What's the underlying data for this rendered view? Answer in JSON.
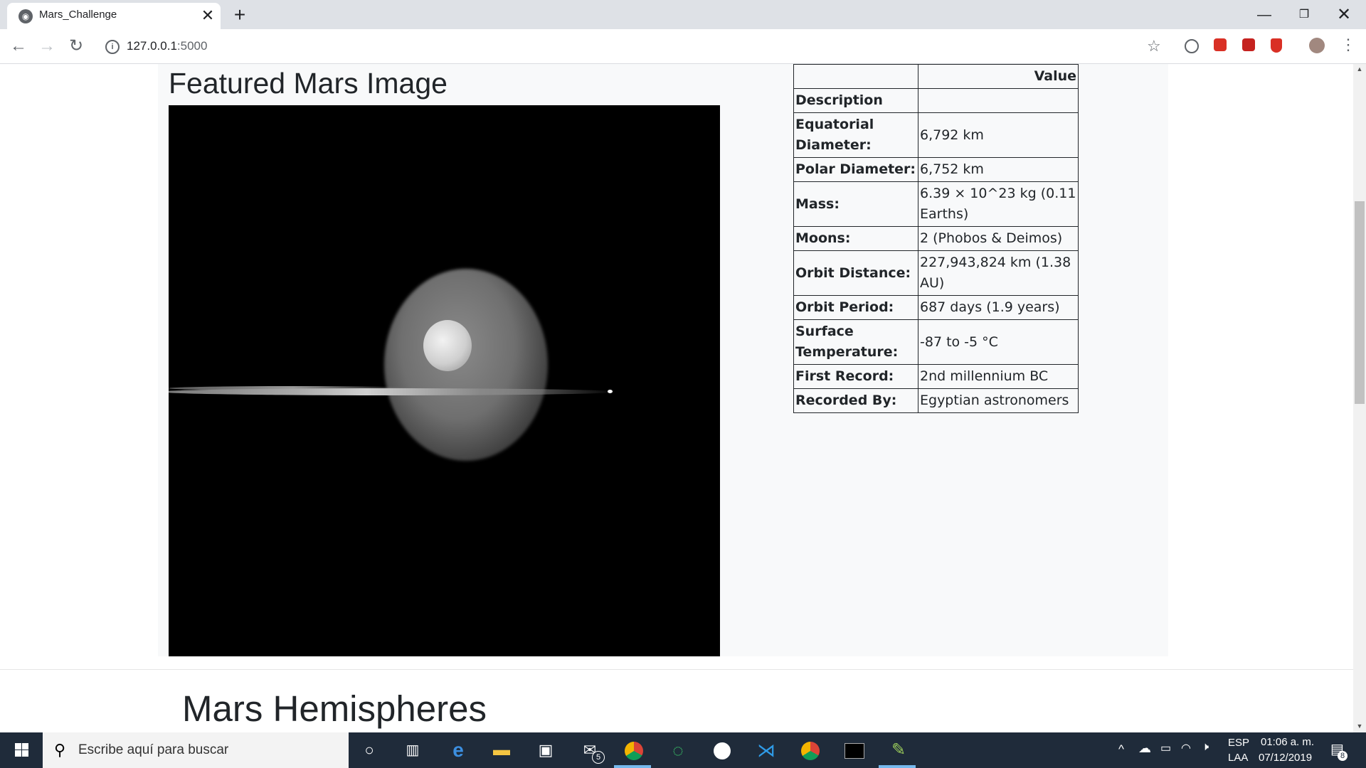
{
  "browser": {
    "tab_title": "Mars_Challenge",
    "tab_close": "✕",
    "new_tab": "+",
    "url_host": "127.0.0.1",
    "url_port": ":5000",
    "window_controls": {
      "minimize": "—",
      "maximize": "❐",
      "close": "✕"
    },
    "icons": {
      "back": "←",
      "forward": "→",
      "reload": "↻",
      "info": "i",
      "star": "☆",
      "menu": "⋮"
    }
  },
  "page": {
    "featured_title": "Featured Mars Image",
    "facts_table": {
      "header": [
        "",
        "Value"
      ],
      "rows": [
        {
          "key": "Description",
          "value": ""
        },
        {
          "key": "Equatorial Diameter:",
          "value": "6,792 km"
        },
        {
          "key": "Polar Diameter:",
          "value": "6,752 km"
        },
        {
          "key": "Mass:",
          "value": "6.39 × 10^23 kg (0.11 Earths)"
        },
        {
          "key": "Moons:",
          "value": "2 (Phobos & Deimos)"
        },
        {
          "key": "Orbit Distance:",
          "value": "227,943,824 km (1.38 AU)"
        },
        {
          "key": "Orbit Period:",
          "value": "687 days (1.9 years)"
        },
        {
          "key": "Surface Temperature:",
          "value": "-87 to -5 °C"
        },
        {
          "key": "First Record:",
          "value": "2nd millennium BC"
        },
        {
          "key": "Recorded By:",
          "value": "Egyptian astronomers"
        }
      ]
    },
    "hemispheres_title": "Mars Hemispheres"
  },
  "taskbar": {
    "search_placeholder": "Escribe aquí para buscar",
    "mail_badge": "5",
    "lang_top": "ESP",
    "lang_bottom": "LAA",
    "time": "01:06 a. m.",
    "date": "07/12/2019",
    "notification_badge": "8",
    "icons": [
      "windows-start-icon",
      "search-icon",
      "cortana-icon",
      "task-view-icon",
      "edge-icon",
      "file-explorer-icon",
      "store-icon",
      "mail-icon",
      "chrome-icon",
      "green-app-icon",
      "mongodb-icon",
      "vscode-icon",
      "chrome-icon-2",
      "terminal-icon",
      "paint-icon"
    ]
  }
}
